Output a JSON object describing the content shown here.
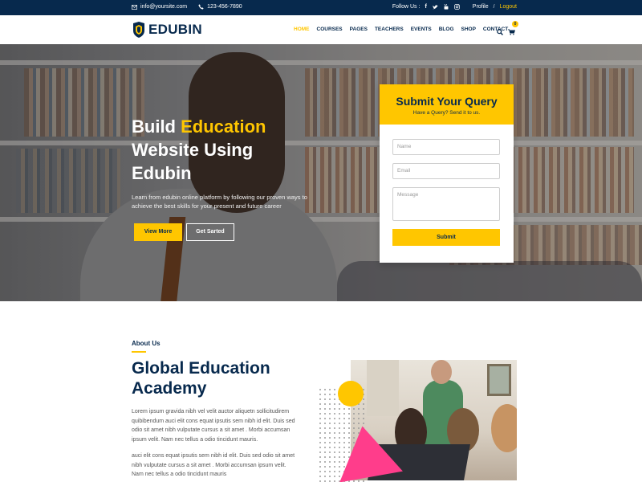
{
  "topbar": {
    "email": "info@yoursite.com",
    "phone": "123-456-7890",
    "follow_label": "Follow Us :",
    "profile": "Profile",
    "separator": "/",
    "logout": "Logout"
  },
  "brand": {
    "name": "EDUBIN"
  },
  "nav": {
    "items": [
      "HOME",
      "COURSES",
      "PAGES",
      "TEACHERS",
      "EVENTS",
      "BLOG",
      "SHOP",
      "CONTACT"
    ],
    "cart_count": "0"
  },
  "hero": {
    "title_line1_a": "Build",
    "title_line1_b": "Education",
    "title_line2": "Website Using",
    "title_line3": "Edubin",
    "subtitle": "Learn from edubin online platform by following our proven ways to achieve the best skills for your present and future career",
    "btn_primary": "View More",
    "btn_secondary": "Get Sarted"
  },
  "query_form": {
    "title": "Submit Your Query",
    "subtitle": "Have a Query? Send it to us.",
    "name_placeholder": "Name",
    "email_placeholder": "Email",
    "message_placeholder": "Message",
    "submit_label": "Submit"
  },
  "about": {
    "label": "About Us",
    "title": "Global Education Academy",
    "paragraph1": "Lorem ipsum gravida nibh vel velit auctor aliquetn sollicitudirem quibibendum auci elit cons equat ipsutis sem nibh id elit. Duis sed odio sit amet nibh vulputate cursus a sit amet . Morbi accumsan ipsum velit. Nam nec tellus a odio tincidunt mauris.",
    "paragraph2": "auci elit cons equat ipsutis sem nibh id elit. Duis sed odio sit amet nibh vulputate cursus a sit amet . Morbi accumsan ipsum velit. Nam nec tellus a odio tincidunt mauris"
  },
  "colors": {
    "navy": "#07294d",
    "accent": "#ffc600",
    "pink": "#ff3d8b"
  },
  "icons": [
    "envelope-icon",
    "phone-icon",
    "facebook-icon",
    "twitter-icon",
    "youtube-icon",
    "instagram-icon",
    "search-icon",
    "cart-icon"
  ]
}
